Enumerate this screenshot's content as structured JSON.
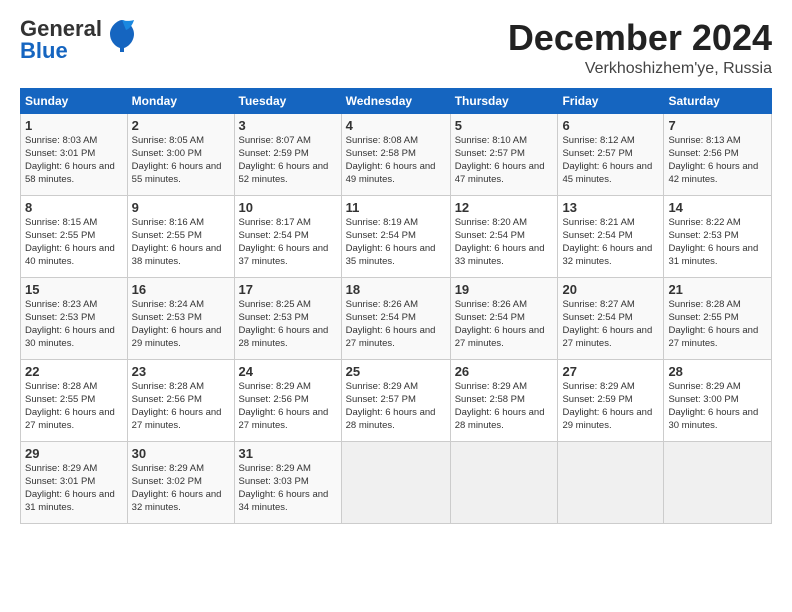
{
  "header": {
    "logo_general": "General",
    "logo_blue": "Blue",
    "month": "December 2024",
    "location": "Verkhoshizhem'ye, Russia"
  },
  "days_of_week": [
    "Sunday",
    "Monday",
    "Tuesday",
    "Wednesday",
    "Thursday",
    "Friday",
    "Saturday"
  ],
  "weeks": [
    [
      {
        "day": 1,
        "sunrise": "8:03 AM",
        "sunset": "3:01 PM",
        "daylight": "6 hours and 58 minutes."
      },
      {
        "day": 2,
        "sunrise": "8:05 AM",
        "sunset": "3:00 PM",
        "daylight": "6 hours and 55 minutes."
      },
      {
        "day": 3,
        "sunrise": "8:07 AM",
        "sunset": "2:59 PM",
        "daylight": "6 hours and 52 minutes."
      },
      {
        "day": 4,
        "sunrise": "8:08 AM",
        "sunset": "2:58 PM",
        "daylight": "6 hours and 49 minutes."
      },
      {
        "day": 5,
        "sunrise": "8:10 AM",
        "sunset": "2:57 PM",
        "daylight": "6 hours and 47 minutes."
      },
      {
        "day": 6,
        "sunrise": "8:12 AM",
        "sunset": "2:57 PM",
        "daylight": "6 hours and 45 minutes."
      },
      {
        "day": 7,
        "sunrise": "8:13 AM",
        "sunset": "2:56 PM",
        "daylight": "6 hours and 42 minutes."
      }
    ],
    [
      {
        "day": 8,
        "sunrise": "8:15 AM",
        "sunset": "2:55 PM",
        "daylight": "6 hours and 40 minutes."
      },
      {
        "day": 9,
        "sunrise": "8:16 AM",
        "sunset": "2:55 PM",
        "daylight": "6 hours and 38 minutes."
      },
      {
        "day": 10,
        "sunrise": "8:17 AM",
        "sunset": "2:54 PM",
        "daylight": "6 hours and 37 minutes."
      },
      {
        "day": 11,
        "sunrise": "8:19 AM",
        "sunset": "2:54 PM",
        "daylight": "6 hours and 35 minutes."
      },
      {
        "day": 12,
        "sunrise": "8:20 AM",
        "sunset": "2:54 PM",
        "daylight": "6 hours and 33 minutes."
      },
      {
        "day": 13,
        "sunrise": "8:21 AM",
        "sunset": "2:54 PM",
        "daylight": "6 hours and 32 minutes."
      },
      {
        "day": 14,
        "sunrise": "8:22 AM",
        "sunset": "2:53 PM",
        "daylight": "6 hours and 31 minutes."
      }
    ],
    [
      {
        "day": 15,
        "sunrise": "8:23 AM",
        "sunset": "2:53 PM",
        "daylight": "6 hours and 30 minutes."
      },
      {
        "day": 16,
        "sunrise": "8:24 AM",
        "sunset": "2:53 PM",
        "daylight": "6 hours and 29 minutes."
      },
      {
        "day": 17,
        "sunrise": "8:25 AM",
        "sunset": "2:53 PM",
        "daylight": "6 hours and 28 minutes."
      },
      {
        "day": 18,
        "sunrise": "8:26 AM",
        "sunset": "2:54 PM",
        "daylight": "6 hours and 27 minutes."
      },
      {
        "day": 19,
        "sunrise": "8:26 AM",
        "sunset": "2:54 PM",
        "daylight": "6 hours and 27 minutes."
      },
      {
        "day": 20,
        "sunrise": "8:27 AM",
        "sunset": "2:54 PM",
        "daylight": "6 hours and 27 minutes."
      },
      {
        "day": 21,
        "sunrise": "8:28 AM",
        "sunset": "2:55 PM",
        "daylight": "6 hours and 27 minutes."
      }
    ],
    [
      {
        "day": 22,
        "sunrise": "8:28 AM",
        "sunset": "2:55 PM",
        "daylight": "6 hours and 27 minutes."
      },
      {
        "day": 23,
        "sunrise": "8:28 AM",
        "sunset": "2:56 PM",
        "daylight": "6 hours and 27 minutes."
      },
      {
        "day": 24,
        "sunrise": "8:29 AM",
        "sunset": "2:56 PM",
        "daylight": "6 hours and 27 minutes."
      },
      {
        "day": 25,
        "sunrise": "8:29 AM",
        "sunset": "2:57 PM",
        "daylight": "6 hours and 28 minutes."
      },
      {
        "day": 26,
        "sunrise": "8:29 AM",
        "sunset": "2:58 PM",
        "daylight": "6 hours and 28 minutes."
      },
      {
        "day": 27,
        "sunrise": "8:29 AM",
        "sunset": "2:59 PM",
        "daylight": "6 hours and 29 minutes."
      },
      {
        "day": 28,
        "sunrise": "8:29 AM",
        "sunset": "3:00 PM",
        "daylight": "6 hours and 30 minutes."
      }
    ],
    [
      {
        "day": 29,
        "sunrise": "8:29 AM",
        "sunset": "3:01 PM",
        "daylight": "6 hours and 31 minutes."
      },
      {
        "day": 30,
        "sunrise": "8:29 AM",
        "sunset": "3:02 PM",
        "daylight": "6 hours and 32 minutes."
      },
      {
        "day": 31,
        "sunrise": "8:29 AM",
        "sunset": "3:03 PM",
        "daylight": "6 hours and 34 minutes."
      },
      null,
      null,
      null,
      null
    ]
  ]
}
